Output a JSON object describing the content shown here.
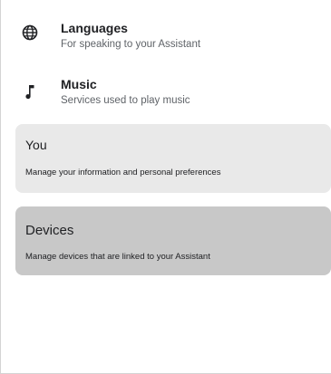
{
  "settings_list": {
    "items": [
      {
        "title": "Languages",
        "subtitle": "For speaking to your Assistant",
        "icon": "globe-icon"
      },
      {
        "title": "Music",
        "subtitle": "Services used to play music",
        "icon": "music-note-icon"
      }
    ]
  },
  "cards": {
    "you": {
      "title": "You",
      "subtitle": "Manage your information and personal preferences"
    },
    "devices": {
      "title": "Devices",
      "subtitle": "Manage devices that are linked to your Assistant"
    }
  },
  "colors": {
    "card_you_bg": "#e9e9e9",
    "card_devices_bg": "#c8c8c8",
    "text_primary": "#202124",
    "text_secondary": "#5f6368"
  }
}
